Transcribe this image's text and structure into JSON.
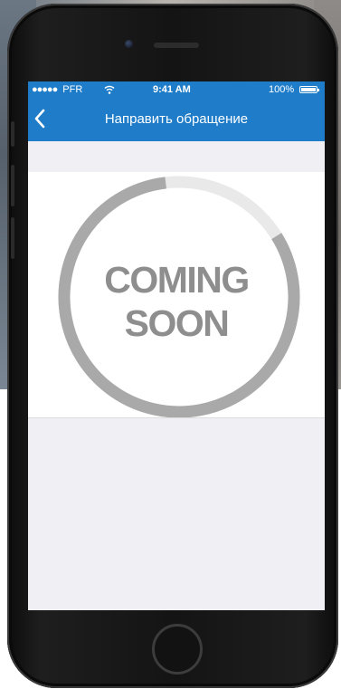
{
  "status_bar": {
    "carrier_dots": "●●●●●",
    "carrier": "PFR",
    "wifi_icon": "wifi-icon",
    "time": "9:41 AM",
    "battery_percent": "100%",
    "battery_icon": "battery-icon"
  },
  "nav_bar": {
    "back_icon": "chevron-left-icon",
    "title": "Направить обращение"
  },
  "placeholder": {
    "line1": "COMING",
    "line2": "SOON",
    "ring_progress": 0.82
  },
  "colors": {
    "accent": "#1e7cc9",
    "ring": "#a9a9a9",
    "ring_track": "#e9e9e9",
    "placeholder_text": "#8e8e8e",
    "screen_bg": "#efeff4"
  }
}
